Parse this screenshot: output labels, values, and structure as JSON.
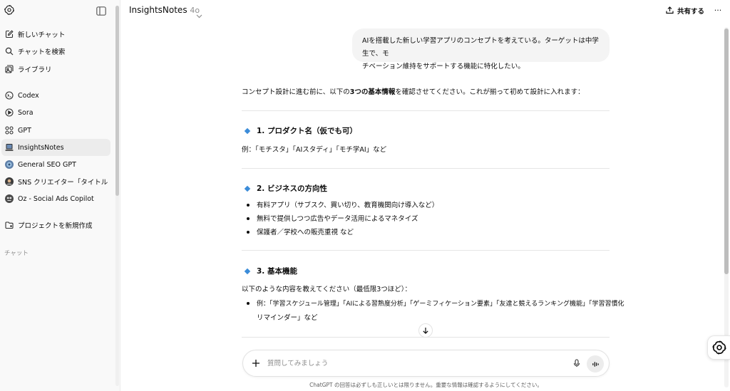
{
  "sidebar": {
    "items": [
      {
        "label": "新しいチャット",
        "icon": "new-chat-icon"
      },
      {
        "label": "チャットを検索",
        "icon": "search-icon"
      },
      {
        "label": "ライブラリ",
        "icon": "library-icon"
      },
      {
        "label": "Codex",
        "icon": "codex-icon"
      },
      {
        "label": "Sora",
        "icon": "sora-icon"
      },
      {
        "label": "GPT",
        "icon": "gpt-grid-icon"
      },
      {
        "label": "InsightsNotes",
        "icon": "notebook-icon"
      },
      {
        "label": "General SEO GPT",
        "icon": "seo-avatar"
      },
      {
        "label": "SNS クリエイター「タイトル・サム...",
        "icon": "sns-avatar"
      },
      {
        "label": "Oz - Social Ads Copilot",
        "icon": "oz-avatar"
      },
      {
        "label": "プロジェクトを新規作成",
        "icon": "new-project-icon"
      }
    ],
    "section_label": "チャット",
    "active_item": "InsightsNotes"
  },
  "header": {
    "model_name": "InsightsNotes",
    "model_version": "4o",
    "share_label": "共有する",
    "more_label": "···"
  },
  "conversation": {
    "user_message_line1": "AIを搭載した新しい学習アプリのコンセプトを考えている。ターゲットは中学生で、モ",
    "user_message_line2": "チベーション維持をサポートする機能に特化したい。",
    "intro_pre": "コンセプト設計に進む前に、以下の",
    "intro_bold": "3つの基本情報",
    "intro_post": "を確認させてください。これが揃って初めて設計に入れます：",
    "sections": [
      {
        "heading": "1. プロダクト名（仮でも可）",
        "text": "例：「モチスタ」「AIスタディ」「モチ学AI」など"
      },
      {
        "heading": "2. ビジネスの方向性",
        "bullets": [
          "有料アプリ（サブスク、買い切り、教育機関向け導入など）",
          "無料で提供しつつ広告やデータ活用によるマネタイズ",
          "保護者／学校への販売重視 など"
        ]
      },
      {
        "heading": "3. 基本機能",
        "text": "以下のような内容を教えてください（最低限3つほど）：",
        "bullet_line1": "例：「学習スケジュール管理」「AIによる習熟度分析」「ゲーミフィケーション要素」「友達と競えるランキング機能」「学習習慣化",
        "bullet_line2": "リマインダー」など"
      }
    ]
  },
  "composer": {
    "placeholder": "質問してみましょう"
  },
  "disclaimer": "ChatGPT の回答は必ずしも正しいとは限りません。重要な情報は確認するようにしてください。",
  "colors": {
    "accent_diamond": "#3b8cd9",
    "sidebar_bg": "#f9f9f9",
    "bubble_bg": "#f4f4f4"
  }
}
